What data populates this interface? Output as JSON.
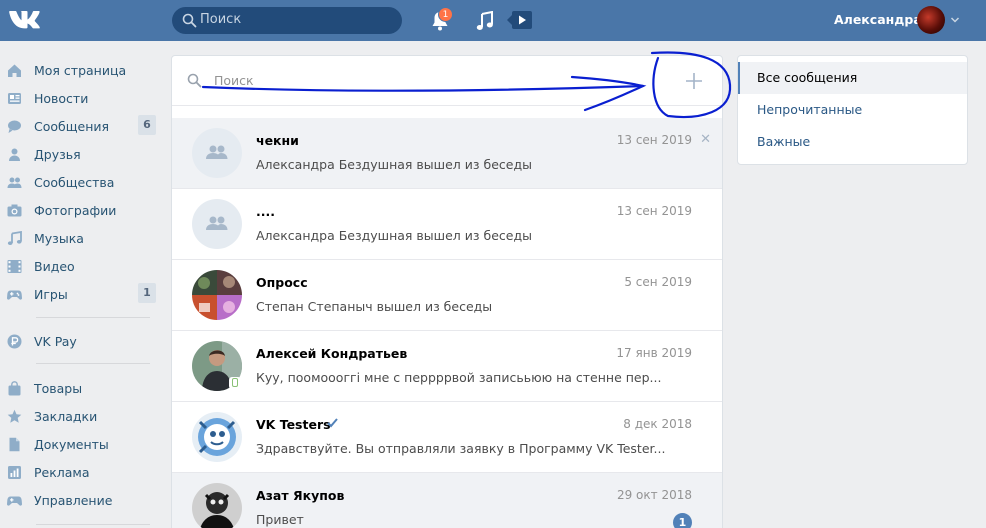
{
  "header": {
    "logo_icon": "vk-logo-icon",
    "search_placeholder": "Поиск",
    "notifications_count": "1",
    "user_name": "Александра"
  },
  "sidebar": {
    "items": [
      {
        "label": "Моя страница",
        "icon": "home-icon"
      },
      {
        "label": "Новости",
        "icon": "news-icon"
      },
      {
        "label": "Сообщения",
        "icon": "messages-icon",
        "count": "6"
      },
      {
        "label": "Друзья",
        "icon": "friend-icon"
      },
      {
        "label": "Сообщества",
        "icon": "groups-icon"
      },
      {
        "label": "Фотографии",
        "icon": "camera-icon"
      },
      {
        "label": "Музыка",
        "icon": "music-icon"
      },
      {
        "label": "Видео",
        "icon": "video-icon"
      },
      {
        "label": "Игры",
        "icon": "gamepad-icon",
        "count": "1"
      },
      {
        "label": "VK Pay",
        "icon": "vkpay-icon"
      },
      {
        "label": "Товары",
        "icon": "bag-icon"
      },
      {
        "label": "Закладки",
        "icon": "star-icon"
      },
      {
        "label": "Документы",
        "icon": "document-icon"
      },
      {
        "label": "Реклама",
        "icon": "ads-icon"
      },
      {
        "label": "Управление",
        "icon": "gamepad-icon"
      }
    ]
  },
  "messages": {
    "search_placeholder": "Поиск",
    "conversations": [
      {
        "name": "чекни",
        "date": "13 сен 2019",
        "text": "Александра Бездушная вышел из беседы"
      },
      {
        "name": "....",
        "date": "13 сен 2019",
        "text": "Александра Бездушная вышел из беседы"
      },
      {
        "name": "Опросс",
        "date": "5 сен 2019",
        "text": "Степан Степаныч вышел из беседы"
      },
      {
        "name": "Алексей Кондратьев",
        "date": "17 янв 2019",
        "text": "Кyy, поомоооггі мне с перрррвой записььюю на стенне пер..."
      },
      {
        "name": "VK Testers",
        "date": "8 дек 2018",
        "text": "Здравствуйте. Вы отправляли заявку в Программу VK Tester..."
      },
      {
        "name": "Азат Якупов",
        "date": "29 окт 2018",
        "text": "Привет",
        "unread": "1"
      }
    ]
  },
  "filters": {
    "items": [
      {
        "label": "Все сообщения"
      },
      {
        "label": "Непрочитанные"
      },
      {
        "label": "Важные"
      }
    ]
  },
  "colors": {
    "header": "#4a76a8",
    "link": "#2a5885",
    "annotation": "#0a1fd0"
  }
}
